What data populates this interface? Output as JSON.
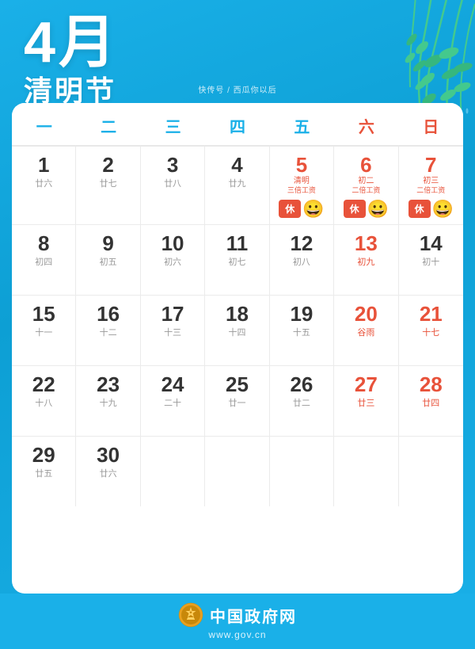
{
  "header": {
    "month": "4月",
    "festival": "清明节",
    "small_text": "快传号 / 西瓜你以后"
  },
  "calendar": {
    "weekdays": [
      "一",
      "二",
      "三",
      "四",
      "五",
      "六",
      "日"
    ],
    "rows": [
      [
        {
          "day": "1",
          "lunar": "廿六",
          "red": false
        },
        {
          "day": "2",
          "lunar": "廿七",
          "red": false
        },
        {
          "day": "3",
          "lunar": "廿八",
          "red": false
        },
        {
          "day": "4",
          "lunar": "廿九",
          "red": false
        },
        {
          "day": "5",
          "lunar": "清明",
          "lunar2": "三倍工资",
          "holiday": "休",
          "emoji": "😀",
          "red": true
        },
        {
          "day": "6",
          "lunar": "初二",
          "lunar2": "二倍工资",
          "holiday": "休",
          "emoji": "😀",
          "red": true
        },
        {
          "day": "7",
          "lunar": "初三",
          "lunar2": "二倍工资",
          "holiday": "休",
          "emoji": "😀",
          "red": true
        }
      ],
      [
        {
          "day": "8",
          "lunar": "初四",
          "red": false
        },
        {
          "day": "9",
          "lunar": "初五",
          "red": false
        },
        {
          "day": "10",
          "lunar": "初六",
          "red": false
        },
        {
          "day": "11",
          "lunar": "初七",
          "red": false
        },
        {
          "day": "12",
          "lunar": "初八",
          "red": false
        },
        {
          "day": "13",
          "lunar": "初九",
          "red": true
        },
        {
          "day": "14",
          "lunar": "初十",
          "red": false
        }
      ],
      [
        {
          "day": "15",
          "lunar": "十一",
          "red": false
        },
        {
          "day": "16",
          "lunar": "十二",
          "red": false
        },
        {
          "day": "17",
          "lunar": "十三",
          "red": false
        },
        {
          "day": "18",
          "lunar": "十四",
          "red": false
        },
        {
          "day": "19",
          "lunar": "十五",
          "red": false
        },
        {
          "day": "20",
          "lunar": "谷雨",
          "red": true
        },
        {
          "day": "21",
          "lunar": "十七",
          "red": true
        }
      ],
      [
        {
          "day": "22",
          "lunar": "十八",
          "red": false
        },
        {
          "day": "23",
          "lunar": "十九",
          "red": false
        },
        {
          "day": "24",
          "lunar": "二十",
          "red": false
        },
        {
          "day": "25",
          "lunar": "廿一",
          "red": false
        },
        {
          "day": "26",
          "lunar": "廿二",
          "red": false
        },
        {
          "day": "27",
          "lunar": "廿三",
          "red": true
        },
        {
          "day": "28",
          "lunar": "廿四",
          "red": true
        }
      ],
      [
        {
          "day": "29",
          "lunar": "廿五",
          "red": false
        },
        {
          "day": "30",
          "lunar": "廿六",
          "red": false
        },
        {
          "day": "",
          "lunar": "",
          "red": false
        },
        {
          "day": "",
          "lunar": "",
          "red": false
        },
        {
          "day": "",
          "lunar": "",
          "red": false
        },
        {
          "day": "",
          "lunar": "",
          "red": false
        },
        {
          "day": "",
          "lunar": "",
          "red": false
        }
      ]
    ]
  },
  "footer": {
    "gov_name": "中国政府网",
    "gov_url": "www.gov.cn"
  }
}
